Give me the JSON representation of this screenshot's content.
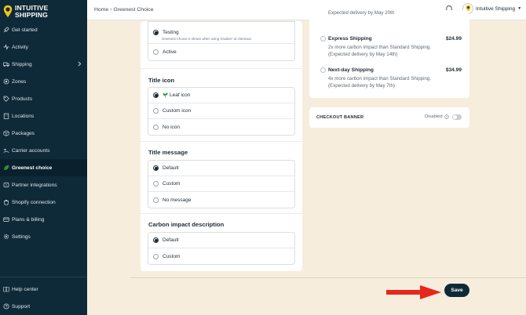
{
  "brand": {
    "line1": "INTUITIVE",
    "line2": "SHIPPING"
  },
  "sidebar": {
    "items": [
      {
        "label": "Get started",
        "icon": "rocket-icon"
      },
      {
        "label": "Activity",
        "icon": "activity-icon"
      },
      {
        "label": "Shipping",
        "icon": "truck-icon",
        "has_submenu": true
      },
      {
        "label": "Zones",
        "icon": "zone-icon"
      },
      {
        "label": "Products",
        "icon": "tag-icon"
      },
      {
        "label": "Locations",
        "icon": "building-icon"
      },
      {
        "label": "Packages",
        "icon": "box-icon"
      },
      {
        "label": "Carrier accounts",
        "icon": "account-icon"
      },
      {
        "label": "Greenest choice",
        "icon": "leaf-icon",
        "active": true
      },
      {
        "label": "Partner integrations",
        "icon": "plug-icon"
      },
      {
        "label": "Shopify connection",
        "icon": "shopify-icon"
      },
      {
        "label": "Plans & billing",
        "icon": "card-icon"
      },
      {
        "label": "Settings",
        "icon": "gear-icon"
      }
    ],
    "bottom": [
      {
        "label": "Help center",
        "icon": "book-icon"
      },
      {
        "label": "Support",
        "icon": "help-icon"
      }
    ]
  },
  "topbar": {
    "breadcrumb": [
      "Home",
      "Greenest Choice"
    ],
    "profile_name": "Intuitive Shipping"
  },
  "preview_mode": {
    "options": [
      {
        "label": "Testing",
        "selected": true,
        "note": "Greenest Choice is shown when using 'intuitive' at checkout."
      },
      {
        "label": "Active",
        "selected": false
      }
    ]
  },
  "title_icon": {
    "title": "Title icon",
    "options": [
      {
        "label": "Leaf icon",
        "selected": true
      },
      {
        "label": "Custom icon",
        "selected": false
      },
      {
        "label": "No icon",
        "selected": false
      }
    ]
  },
  "title_message": {
    "title": "Title message",
    "options": [
      {
        "label": "Default",
        "selected": true
      },
      {
        "label": "Custom",
        "selected": false
      },
      {
        "label": "No message",
        "selected": false
      }
    ]
  },
  "carbon_description": {
    "title": "Carbon impact description",
    "options": [
      {
        "label": "Default",
        "selected": true
      },
      {
        "label": "Custom",
        "selected": false
      }
    ]
  },
  "preview": {
    "top_text": "Expected delivery by May 20th",
    "rates": [
      {
        "name": "Express Shipping",
        "price": "$24.99",
        "line1": "2x more carbon impact than Standard Shipping.",
        "line2": "(Expected delivery by May 14th)"
      },
      {
        "name": "Next-day Shipping",
        "price": "$34.99",
        "line1": "4x more carbon impact than Standard Shipping.",
        "line2": "(Expected delivery by May 7th)"
      }
    ]
  },
  "checkout_banner": {
    "title": "CHECKOUT BANNER",
    "status": "Disabled",
    "enabled": false
  },
  "save_label": "Save",
  "colors": {
    "sidebar_bg": "#0e2a38",
    "page_bg": "#f7eddd",
    "arrow": "#e8261c",
    "accent_yellow": "#f2c21b",
    "leaf_green": "#3a9a3e"
  }
}
